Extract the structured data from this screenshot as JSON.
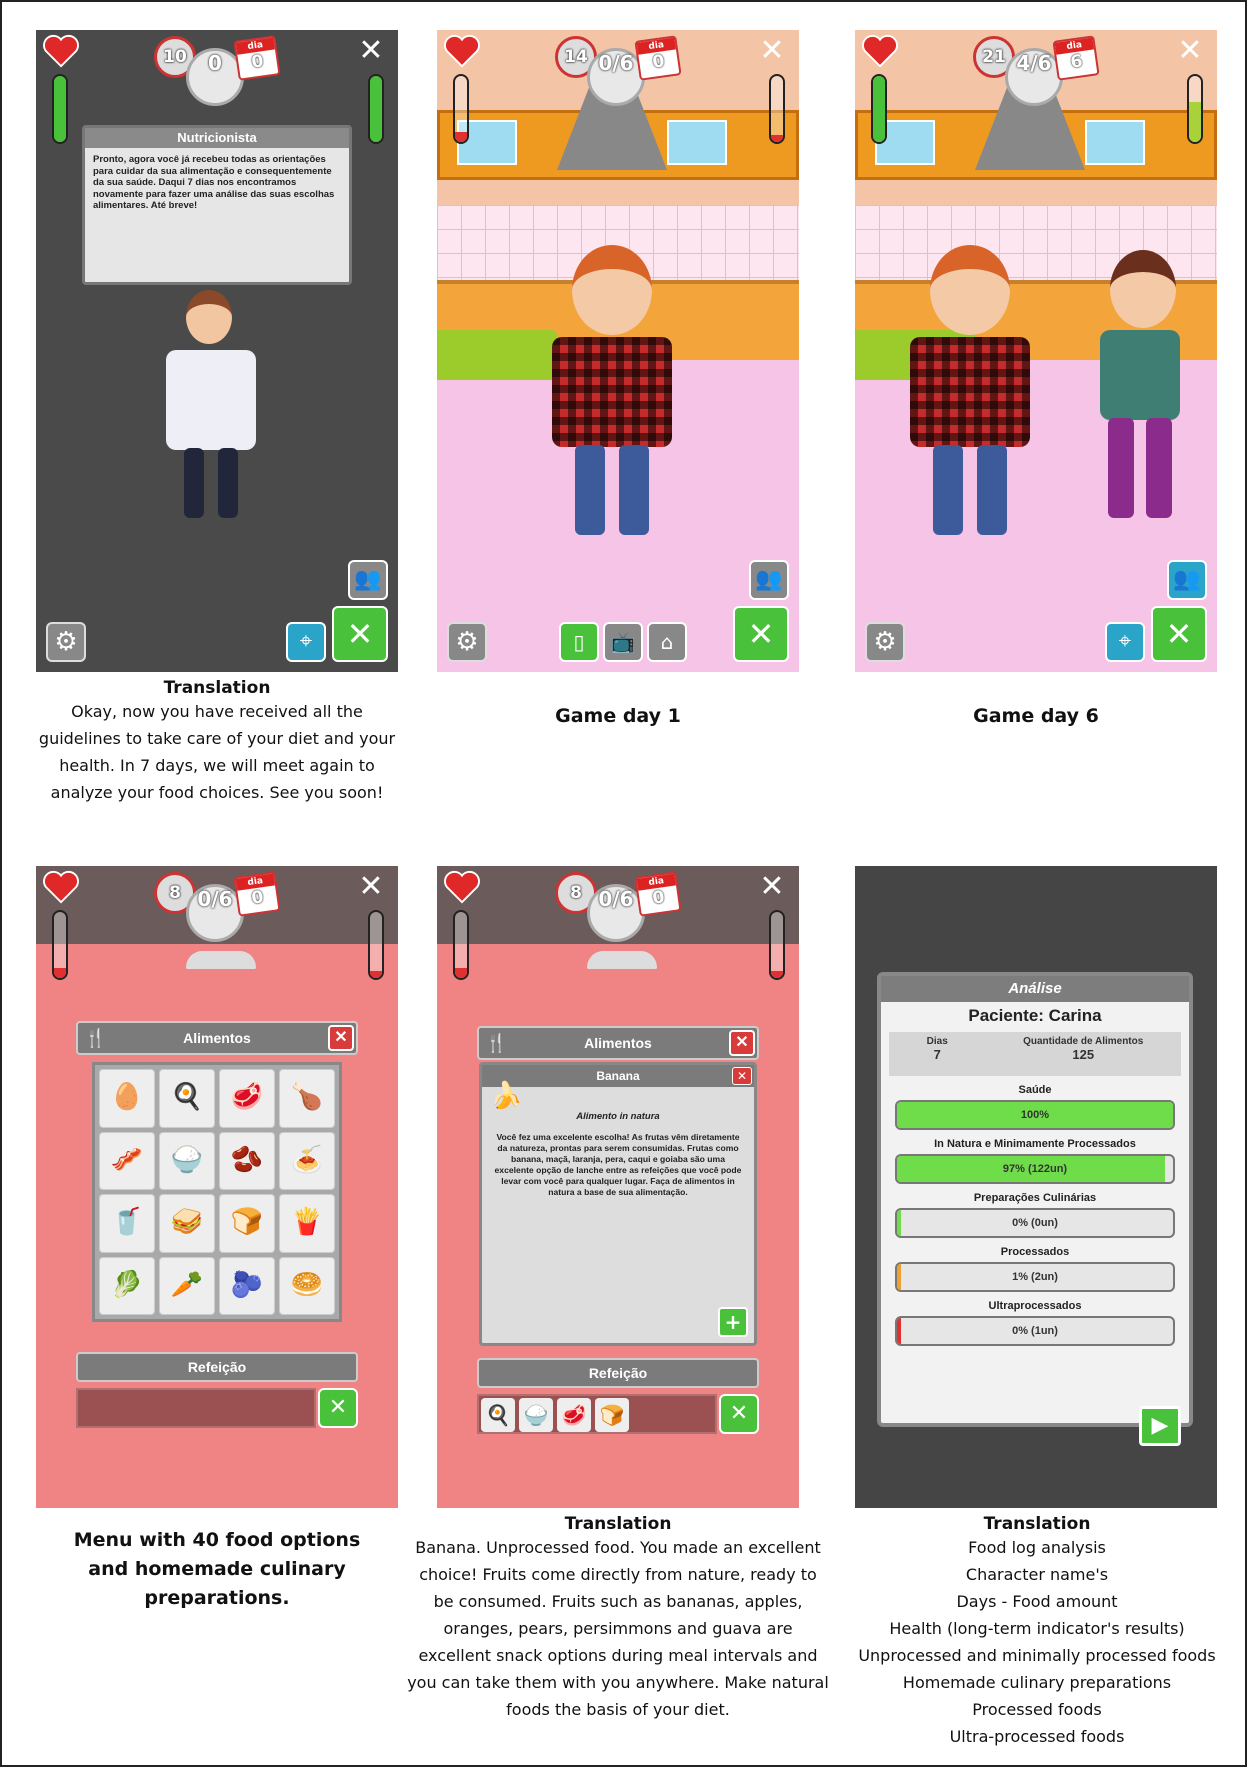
{
  "panel1": {
    "clock": "10",
    "plate": "0",
    "dia_label": "dia",
    "day": "0",
    "health_level": 1.0,
    "hunger_level": 1.0,
    "dialog_title": "Nutricionista",
    "dialog_text": "Pronto, agora você já recebeu todas as orientações para cuidar da sua alimentação e consequentemente da sua saúde. Daqui 7 dias nos encontramos novamente para fazer uma análise das suas escolhas alimentares. Até breve!",
    "caption_title": "Translation",
    "caption_text": "Okay, now you have received all the guidelines to take care of your diet and your health. In 7 days, we will meet again to analyze your food choices. See you soon!"
  },
  "panel2": {
    "clock": "14",
    "plate": "0/6",
    "dia_label": "dia",
    "day": "0",
    "health_level": 0.15,
    "hunger_level": 0.1,
    "caption": "Game day 1"
  },
  "panel3": {
    "clock": "21",
    "plate": "4/6",
    "dia_label": "dia",
    "day": "6",
    "health_level": 1.0,
    "hunger_level": 0.6,
    "caption": "Game day 6"
  },
  "panel4": {
    "clock": "8",
    "plate": "0/6",
    "dia_label": "dia",
    "day": "0",
    "health_level": 0.15,
    "hunger_level": 0.1,
    "menu_title": "Alimentos",
    "meal_title": "Refeição",
    "foods": [
      "🥚",
      "🍳",
      "🥩",
      "🍗",
      "🥓",
      "🍚",
      "🫘",
      "🍝",
      "🥤",
      "🥪",
      "🍞",
      "🍟",
      "🥬",
      "🥕",
      "🫐",
      "🥯"
    ],
    "caption": "Menu with 40 food options and homemade culinary preparations."
  },
  "panel5": {
    "clock": "8",
    "plate": "0/6",
    "dia_label": "dia",
    "day": "0",
    "health_level": 0.15,
    "hunger_level": 0.1,
    "menu_title": "Alimentos",
    "food_name": "Banana",
    "food_category": "Alimento in natura",
    "food_message": "Você fez uma excelente escolha! As frutas vêm diretamente da natureza, prontas para serem consumidas. Frutas como banana, maçã, laranja, pera, caqui e goiaba são uma excelente opção de lanche entre as refeições que você pode levar com você para qualquer lugar. Faça de alimentos in natura a base de sua alimentação.",
    "meal_title": "Refeição",
    "meal_items": [
      "🍳",
      "🍚",
      "🥩",
      "🍞"
    ],
    "caption_title": "Translation",
    "caption_text": "Banana. Unprocessed food. You made an excellent choice! Fruits come directly from nature, ready to be consumed. Fruits such as bananas, apples, oranges, pears, persimmons and guava are excellent snack options during meal intervals and you can take them with you anywhere. Make natural foods the basis of your diet."
  },
  "panel6": {
    "title": "Análise",
    "patient": "Paciente: Carina",
    "days_label": "Dias",
    "days_value": "7",
    "qty_label": "Quantidade de Alimentos",
    "qty_value": "125",
    "bars": [
      {
        "label": "Saúde",
        "text": "100%",
        "value": 1.0,
        "color": "#6fdc4a"
      },
      {
        "label": "In Natura e Minimamente Processados",
        "text": "97% (122un)",
        "value": 0.97,
        "color": "#6fdc4a"
      },
      {
        "label": "Preparações Culinárias",
        "text": "0% (0un)",
        "value": 0.0,
        "color": "#6fdc4a"
      },
      {
        "label": "Processados",
        "text": "1% (2un)",
        "value": 0.01,
        "color": "#f0a030"
      },
      {
        "label": "Ultraprocessados",
        "text": "0% (1un)",
        "value": 0.008,
        "color": "#e03030"
      }
    ],
    "caption_title": "Translation",
    "caption_lines": [
      "Food log analysis",
      "Character name's",
      "Days - Food amount",
      "Health (long-term indicator's results)",
      "Unprocessed and minimally processed foods",
      "Homemade culinary preparations",
      "Processed foods",
      "Ultra-processed foods"
    ]
  },
  "colors": {
    "green": "#49c13a",
    "red": "#d93b3b",
    "blue": "#2aa4c8"
  }
}
